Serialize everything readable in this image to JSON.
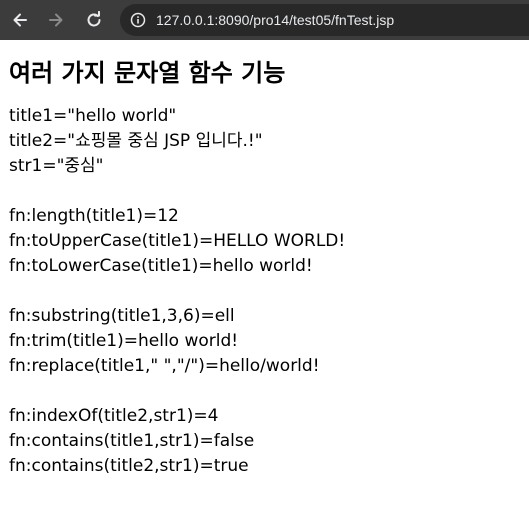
{
  "browser": {
    "url": "127.0.0.1:8090/pro14/test05/fnTest.jsp",
    "icons": {
      "back": "back-arrow-icon",
      "forward": "forward-arrow-icon",
      "reload": "reload-icon",
      "site_info": "info-icon"
    },
    "colors": {
      "toolbar": "#3c3c3c",
      "omnibox": "#282828",
      "url_text": "#e8eaed"
    }
  },
  "page": {
    "title": "여러 가지 문자열 함수 기능",
    "lines": [
      "title1=\"hello world\"",
      "title2=\"쇼핑몰 중심 JSP 입니다.!\"",
      "str1=\"중심\"",
      "",
      "fn:length(title1)=12",
      "fn:toUpperCase(title1)=HELLO WORLD!",
      "fn:toLowerCase(title1)=hello world!",
      "",
      "fn:substring(title1,3,6)=ell",
      "fn:trim(title1)=hello world!",
      "fn:replace(title1,\" \",\"/\")=hello/world!",
      "",
      "fn:indexOf(title2,str1)=4",
      "fn:contains(title1,str1)=false",
      "fn:contains(title2,str1)=true"
    ]
  }
}
